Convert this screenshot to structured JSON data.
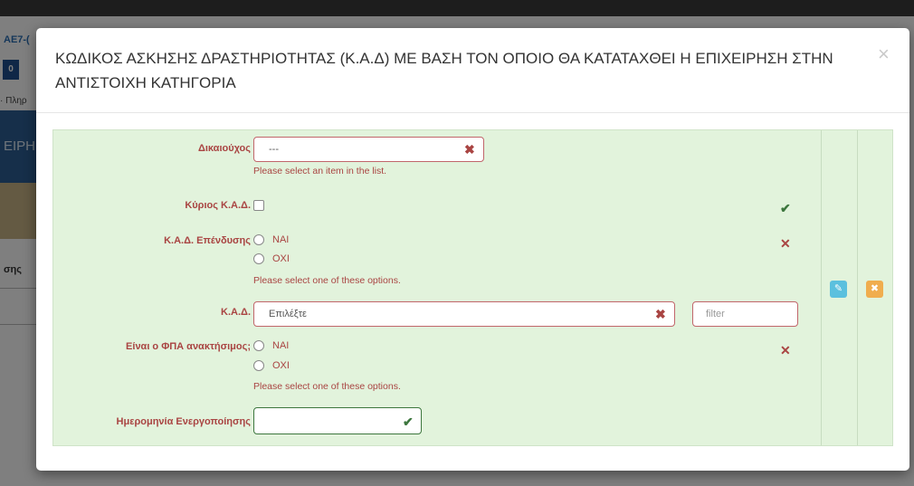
{
  "background": {
    "code": "AE7-(",
    "button": "0",
    "subtitle": "· Πληρ",
    "banner": "ΕΙΡΗ",
    "word": "σης"
  },
  "modal": {
    "title": "ΚΩΔΙΚΟΣ ΑΣΚΗΣΗΣ ΔΡΑΣΤΗΡΙΟΤΗΤΑΣ (Κ.Α.Δ) ΜΕ ΒΑΣΗ ΤΟΝ ΟΠΟΙΟ ΘΑ ΚΑΤΑΤΑΧΘΕΙ Η ΕΠΙΧΕΙΡΗΣΗ ΣΤΗΝ ΑΝΤΙΣΤΟΙΧΗ ΚΑΤΗΓΟΡΙΑ",
    "close_symbol": "×"
  },
  "form": {
    "beneficiary": {
      "label": "Δικαιούχος",
      "value": "---",
      "help": "Please select an item in the list."
    },
    "main_kad": {
      "label": "Κύριος Κ.Α.Δ."
    },
    "investment_kad": {
      "label": "Κ.Α.Δ. Επένδυσης",
      "option_yes": "ΝΑΙ",
      "option_no": "ΟΧΙ",
      "help": "Please select one of these options."
    },
    "kad": {
      "label": "Κ.Α.Δ.",
      "value": "Επιλέξτε",
      "filter_placeholder": "filter"
    },
    "vat_recoverable": {
      "label": "Είναι ο ΦΠΑ ανακτήσιμος;",
      "option_yes": "ΝΑΙ",
      "option_no": "ΟΧΙ",
      "help": "Please select one of these options."
    },
    "activation_date": {
      "label": "Ημερομηνία Ενεργοποίησης",
      "value": ""
    }
  },
  "icons": {
    "clear": "✖",
    "invalid": "✕",
    "valid": "✔",
    "save": "✎",
    "cancel": "✖"
  },
  "colors": {
    "panel_bg": "#e2f3dc",
    "error": "#a94442",
    "success": "#3c763d",
    "save_button": "#5bc0de",
    "cancel_button": "#f0ad4e"
  }
}
